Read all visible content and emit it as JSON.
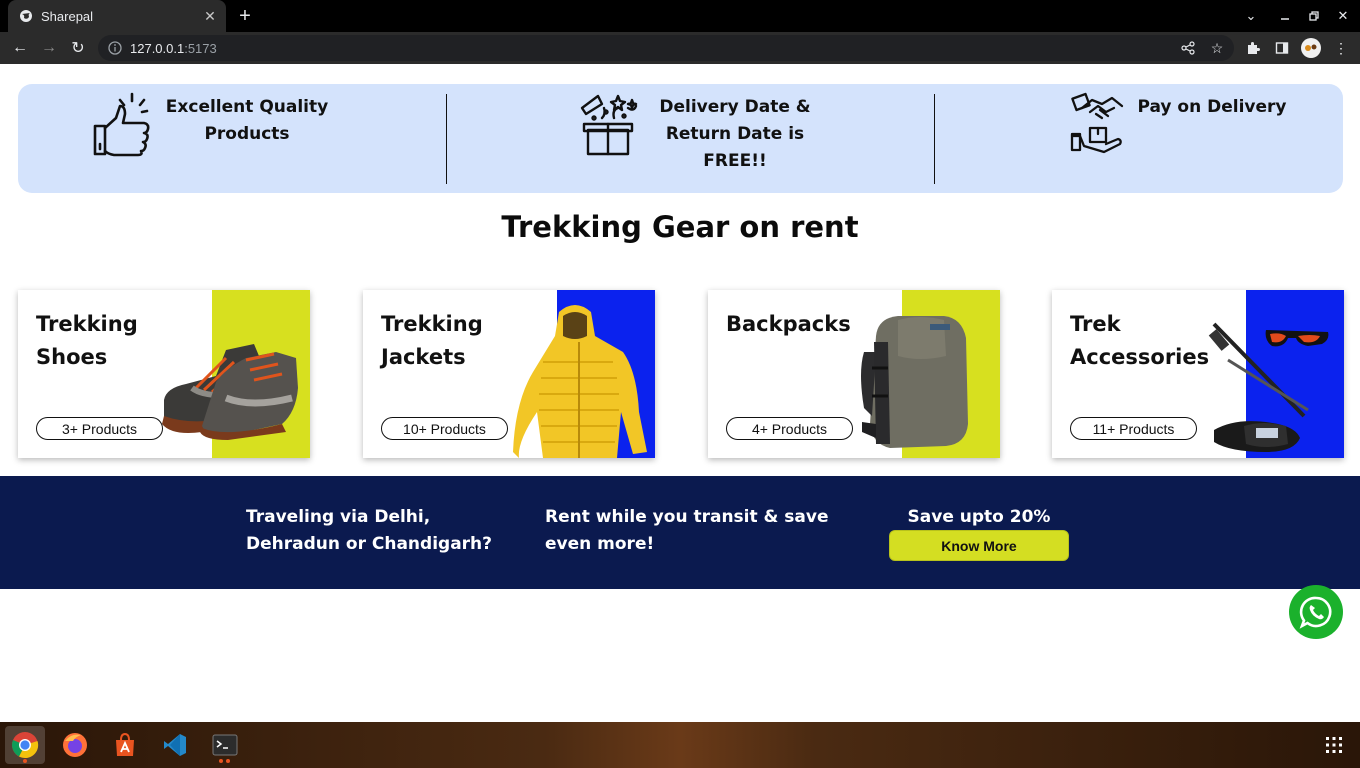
{
  "browser": {
    "tab_title": "Sharepal",
    "url_host": "127.0.0.1",
    "url_port": ":5173"
  },
  "features": [
    {
      "line1": "Excellent Quality",
      "line2": "Products",
      "line3": ""
    },
    {
      "line1": "Delivery Date &",
      "line2": "Return Date is",
      "line3": "FREE!!"
    },
    {
      "line1": "Pay on Delivery",
      "line2": "",
      "line3": ""
    }
  ],
  "section_title": "Trekking Gear on rent",
  "categories": [
    {
      "line1": "Trekking",
      "line2": "Shoes",
      "count": "3+ Products",
      "accent": "#d7e01f"
    },
    {
      "line1": "Trekking",
      "line2": "Jackets",
      "count": "10+ Products",
      "accent": "#0b22ee"
    },
    {
      "line1": "Backpacks",
      "line2": "",
      "count": "4+ Products",
      "accent": "#d7e01f"
    },
    {
      "line1": "Trek",
      "line2": "Accessories",
      "count": "11+ Products",
      "accent": "#0b22ee"
    }
  ],
  "banner": {
    "left_line1": "Traveling via Delhi,",
    "left_line2": "Dehradun or Chandigarh?",
    "mid_line1": "Rent while you transit & save",
    "mid_line2": "even more!",
    "right_title": "Save upto 20%",
    "cta_label": "Know More",
    "bg_color": "#0b1a4f",
    "cta_color": "#d4de22"
  },
  "taskbar": {
    "apps": [
      "chrome-icon",
      "firefox-icon",
      "app-center-icon",
      "vscode-icon",
      "terminal-icon"
    ]
  }
}
